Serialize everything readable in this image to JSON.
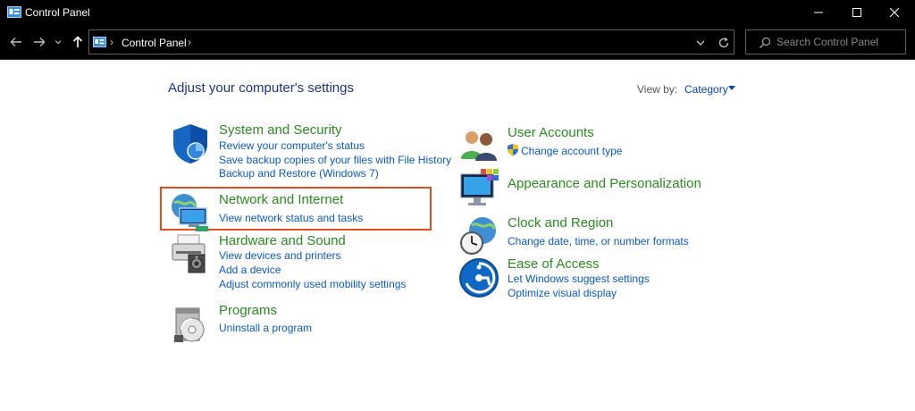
{
  "window": {
    "title": "Control Panel",
    "buttons": [
      "minimize",
      "maximize",
      "close"
    ]
  },
  "address_bar": {
    "breadcrumb": "Control Panel",
    "search_placeholder": "Search Control Panel"
  },
  "content": {
    "heading": "Adjust your computer's settings",
    "view_by_label": "View by:",
    "view_by_value": "Category",
    "left_categories": [
      {
        "title": "System and Security",
        "icon": "shield-icon",
        "links": [
          "Review your computer's status",
          "Save backup copies of your files with File History",
          "Backup and Restore (Windows 7)"
        ]
      },
      {
        "title": "Network and Internet",
        "icon": "network-globe-icon",
        "links": [
          "View network status and tasks"
        ],
        "highlighted": true
      },
      {
        "title": "Hardware and Sound",
        "icon": "printer-speaker-icon",
        "links": [
          "View devices and printers",
          "Add a device",
          "Adjust commonly used mobility settings"
        ]
      },
      {
        "title": "Programs",
        "icon": "programs-disc-icon",
        "links": [
          "Uninstall a program"
        ]
      }
    ],
    "right_categories": [
      {
        "title": "User Accounts",
        "icon": "users-icon",
        "links": [
          "Change account type"
        ]
      },
      {
        "title": "Appearance and Personalization",
        "icon": "monitor-palette-icon",
        "links": []
      },
      {
        "title": "Clock and Region",
        "icon": "clock-globe-icon",
        "links": [
          "Change date, time, or number formats"
        ]
      },
      {
        "title": "Ease of Access",
        "icon": "ease-of-access-icon",
        "links": [
          "Let Windows suggest settings",
          "Optimize visual display"
        ]
      }
    ]
  },
  "colors": {
    "titlebar": "#000000",
    "category_title": "#2a8a1f",
    "link": "#0a58c9",
    "heading": "#1e3287",
    "highlight_border": "#e0501f"
  }
}
